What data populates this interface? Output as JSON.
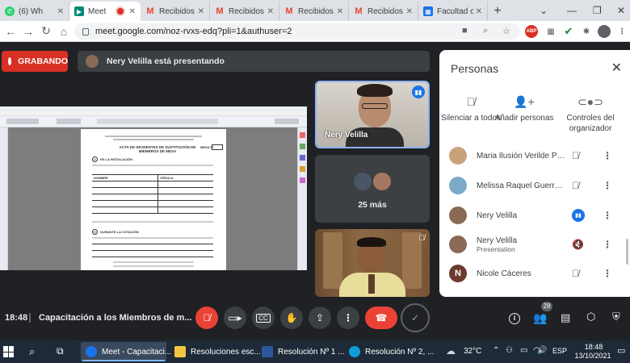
{
  "browser": {
    "tabs": [
      {
        "label": "(6) Wh",
        "color": "#25d366"
      },
      {
        "label": "Meet",
        "color": "#00897b"
      },
      {
        "label": "Recibidos",
        "color": "#ea4335"
      },
      {
        "label": "Recibidos",
        "color": "#ea4335"
      },
      {
        "label": "Recibidos",
        "color": "#ea4335"
      },
      {
        "label": "Recibidos",
        "color": "#ea4335"
      },
      {
        "label": "Facultad c",
        "color": "#1a73e8"
      }
    ],
    "url": "meet.google.com/noz-rvxs-edq?pli=1&authuser=2"
  },
  "meet": {
    "recording_label": "GRABANDO",
    "presenting_text": "Nery Velilla está presentando",
    "tiles": {
      "presenter_name": "Nery Velilla",
      "more_count": "25 más"
    },
    "document": {
      "title": "ACTA DE INCIDENTES DE SUSTITUCIÓN DE MIEMBROS DE MESA",
      "mesa_label": "MESA N°",
      "section_a": "EN LA INSTALACIÓN",
      "section_b": "DURANTE LA VOTACIÓN",
      "col_nombre": "NOMBRE",
      "col_cedula": "CÉDULA"
    },
    "meeting_time": "18:48",
    "meeting_title": "Capacitación a los Miembros de m...",
    "participants_badge": "28"
  },
  "people_panel": {
    "title": "Personas",
    "actions": [
      {
        "label": "Silenciar a todos"
      },
      {
        "label": "Añadir personas"
      },
      {
        "label": "Controles del organizador"
      }
    ],
    "participants": [
      {
        "name": "Maria Ilusión Verilde Peral...",
        "sub": "",
        "mic": "off",
        "avatar": "#c9a27c"
      },
      {
        "name": "Melissa Raquel Guerrero ...",
        "sub": "",
        "mic": "off",
        "avatar": "#7aa9c9"
      },
      {
        "name": "Nery Velilla",
        "sub": "",
        "mic": "speaking",
        "avatar": "#8a6a55"
      },
      {
        "name": "Nery Velilla",
        "sub": "Presentation",
        "mic": "present",
        "avatar": "#8a6a55"
      },
      {
        "name": "Nicole Cáceres",
        "sub": "",
        "mic": "off",
        "avatar": "#6d3b2e",
        "initial": "N"
      }
    ]
  },
  "taskbar": {
    "items": [
      {
        "label": "Meet - Capacitaci...",
        "color": "#1a73e8"
      },
      {
        "label": "Resoluciones esc...",
        "color": "#f4c542"
      },
      {
        "label": "Resolución Nº 1 ...",
        "color": "#2b579a"
      },
      {
        "label": "Resolución Nº 2, ...",
        "color": "#0f9cd8"
      }
    ],
    "weather": "32°C",
    "lang": "ESP",
    "time": "18:48",
    "date": "13/10/2021"
  }
}
